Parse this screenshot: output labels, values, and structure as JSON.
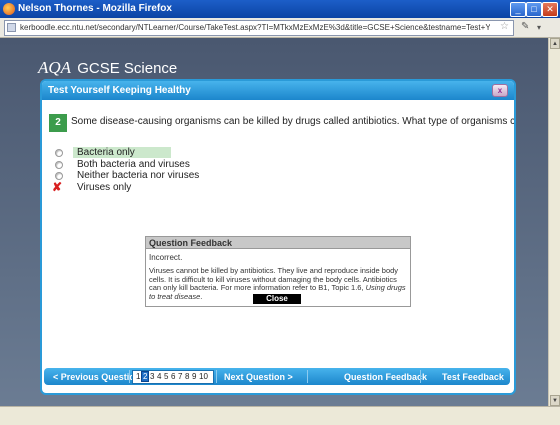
{
  "window": {
    "title": "Nelson Thornes - Mozilla Firefox",
    "url": "kerboodle.ecc.ntu.net/secondary/NTLearner/Course/TakeTest.aspx?TI=MTkxMzExMzE%3d&title=GCSE+Science&testname=Test+Yourself+Keeping+Healthy&M=tryOut"
  },
  "logo": {
    "brand": "AQA",
    "product": "GCSE Science"
  },
  "panel": {
    "title": "Test Yourself Keeping Healthy",
    "close_icon": "x"
  },
  "question": {
    "number": "2",
    "text": "Some disease-causing organisms can be killed by drugs called antibiotics. What type of organisms can antibiotics kill?",
    "options": [
      {
        "label": "Bacteria only",
        "state": "correct"
      },
      {
        "label": "Both bacteria and viruses",
        "state": "none"
      },
      {
        "label": "Neither bacteria nor viruses",
        "state": "none"
      },
      {
        "label": "Viruses only",
        "state": "wrong-selected"
      }
    ]
  },
  "feedback": {
    "title": "Question Feedback",
    "result": "Incorrect.",
    "text_main": "Viruses cannot be killed by antibiotics. They live and reproduce inside body cells. It is difficult to kill viruses without damaging the body cells. Antibiotics can only kill bacteria. For more information refer to B1, Topic 1.6, ",
    "text_italic": "Using drugs to treat disease",
    "text_end": ".",
    "close_label": "Close"
  },
  "nav": {
    "prev_label": "< Previous Question",
    "next_label": "Next Question >",
    "question_feedback_label": "Question Feedback",
    "test_feedback_label": "Test Feedback",
    "pages": [
      "1",
      "2",
      "3",
      "4",
      "5",
      "6",
      "7",
      "8",
      "9",
      "10"
    ],
    "current_page": "2"
  },
  "colors": {
    "panel_blue": "#2a9ad8",
    "correct_highlight": "#cce8cc",
    "question_number_bg": "#3c9c4c",
    "wrong_mark": "#d82020"
  }
}
